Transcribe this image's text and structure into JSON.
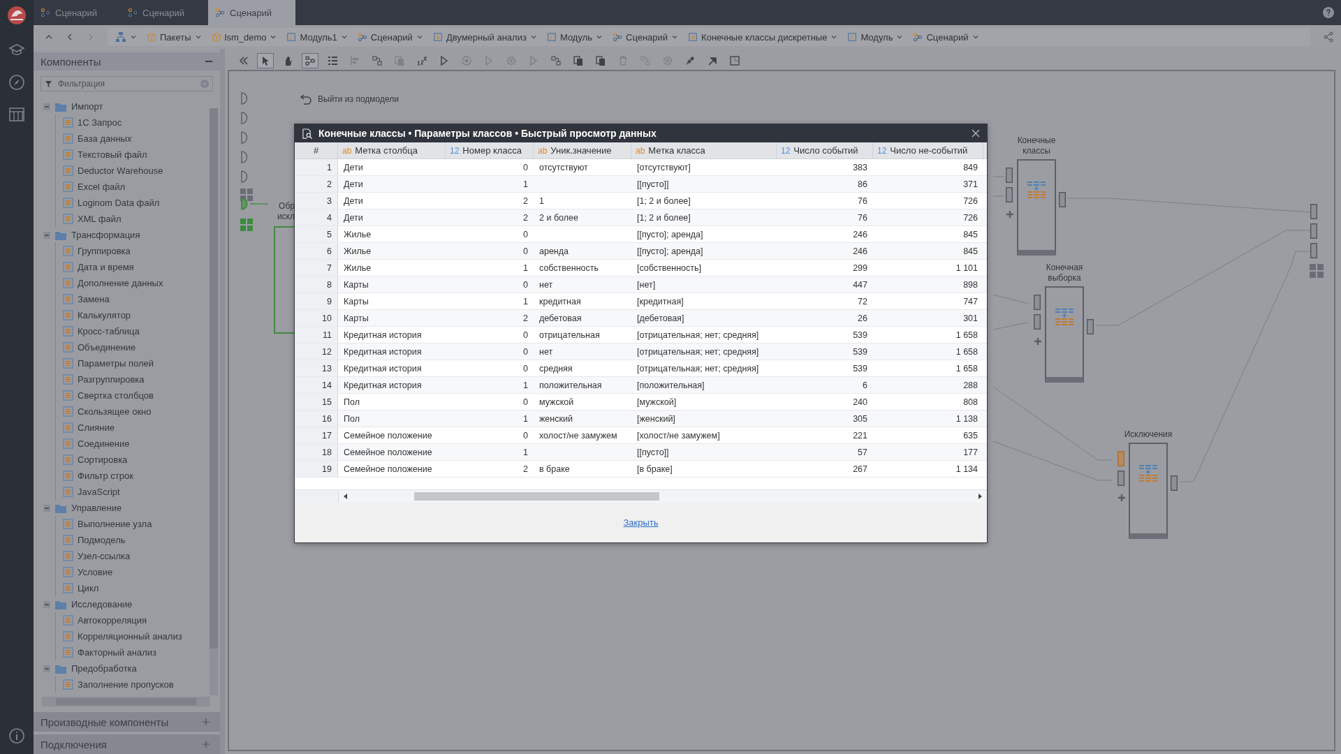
{
  "tabs": [
    {
      "label": "Сценарий",
      "selected": false
    },
    {
      "label": "Сценарий",
      "selected": false
    },
    {
      "label": "Сценарий",
      "selected": true
    }
  ],
  "breadcrumbs": [
    {
      "label": "Пакеты",
      "kind": "package"
    },
    {
      "label": "lsm_demo",
      "kind": "package"
    },
    {
      "label": "Модуль1",
      "kind": "module"
    },
    {
      "label": "Сценарий",
      "kind": "scenario"
    },
    {
      "label": "Двумерный анализ",
      "kind": "submodel"
    },
    {
      "label": "Модуль",
      "kind": "module"
    },
    {
      "label": "Сценарий",
      "kind": "scenario"
    },
    {
      "label": "Конечные классы дискретные",
      "kind": "submodel"
    },
    {
      "label": "Модуль",
      "kind": "module"
    },
    {
      "label": "Сценарий",
      "kind": "scenario"
    }
  ],
  "sidebar": {
    "title": "Компоненты",
    "filter": {
      "placeholder": "Фильтрация"
    },
    "tree": [
      {
        "label": "Импорт",
        "expanded": true,
        "children": [
          {
            "label": "1С Запрос"
          },
          {
            "label": "База данных"
          },
          {
            "label": "Текстовый файл"
          },
          {
            "label": "Deductor Warehouse"
          },
          {
            "label": "Excel файл"
          },
          {
            "label": "Loginom Data файл"
          },
          {
            "label": "XML файл"
          }
        ]
      },
      {
        "label": "Трансформация",
        "expanded": true,
        "children": [
          {
            "label": "Группировка"
          },
          {
            "label": "Дата и время"
          },
          {
            "label": "Дополнение данных"
          },
          {
            "label": "Замена"
          },
          {
            "label": "Калькулятор"
          },
          {
            "label": "Кросс-таблица"
          },
          {
            "label": "Объединение"
          },
          {
            "label": "Параметры полей"
          },
          {
            "label": "Разгруппировка"
          },
          {
            "label": "Свертка столбцов"
          },
          {
            "label": "Скользящее окно"
          },
          {
            "label": "Слияние"
          },
          {
            "label": "Соединение"
          },
          {
            "label": "Сортировка"
          },
          {
            "label": "Фильтр строк"
          },
          {
            "label": "JavaScript"
          }
        ]
      },
      {
        "label": "Управление",
        "expanded": true,
        "children": [
          {
            "label": "Выполнение узла"
          },
          {
            "label": "Подмодель"
          },
          {
            "label": "Узел-ссылка"
          },
          {
            "label": "Условие"
          },
          {
            "label": "Цикл"
          }
        ]
      },
      {
        "label": "Исследование",
        "expanded": true,
        "children": [
          {
            "label": "Автокорреляция"
          },
          {
            "label": "Корреляционный анализ"
          },
          {
            "label": "Факторный анализ"
          }
        ]
      },
      {
        "label": "Предобработка",
        "expanded": true,
        "children": [
          {
            "label": "Заполнение пропусков"
          }
        ]
      }
    ],
    "panels": [
      {
        "label": "Производные компоненты"
      },
      {
        "label": "Подключения"
      }
    ]
  },
  "toolbar": [
    {
      "kind": "collapse",
      "selected": false,
      "disabled": false
    },
    {
      "kind": "pointer",
      "selected": true,
      "disabled": false
    },
    {
      "kind": "hand",
      "selected": false,
      "disabled": false
    },
    {
      "kind": "graph",
      "selected": true,
      "disabled": false
    },
    {
      "kind": "list",
      "selected": false,
      "disabled": false
    },
    {
      "kind": "align",
      "selected": false,
      "disabled": true
    },
    {
      "kind": "layout",
      "selected": false,
      "disabled": false
    },
    {
      "kind": "copy",
      "selected": false,
      "disabled": true
    },
    {
      "kind": "numbers",
      "selected": false,
      "disabled": false
    },
    {
      "kind": "run",
      "selected": false,
      "disabled": false
    },
    {
      "kind": "stop",
      "selected": false,
      "disabled": true
    },
    {
      "kind": "run",
      "selected": false,
      "disabled": true
    },
    {
      "kind": "settings",
      "selected": false,
      "disabled": true
    },
    {
      "kind": "run",
      "selected": false,
      "disabled": true
    },
    {
      "kind": "layout",
      "selected": false,
      "disabled": false
    },
    {
      "kind": "copy",
      "selected": false,
      "disabled": false
    },
    {
      "kind": "copy",
      "selected": false,
      "disabled": false
    },
    {
      "kind": "delete",
      "selected": false,
      "disabled": true
    },
    {
      "kind": "layout",
      "selected": false,
      "disabled": true
    },
    {
      "kind": "settings",
      "selected": false,
      "disabled": true
    },
    {
      "kind": "link",
      "selected": false,
      "disabled": false
    },
    {
      "kind": "arrow",
      "selected": false,
      "disabled": false
    },
    {
      "kind": "select",
      "selected": false,
      "disabled": false
    }
  ],
  "canvas": {
    "exit_label": "Выйти из подмодели",
    "cut_label": [
      "Обр",
      "искл"
    ],
    "nodes": [
      {
        "label": "Конечные классы",
        "inputs": [
          {
            "warning": false
          },
          {
            "warning": false
          }
        ]
      },
      {
        "label": "Конечная выборка",
        "inputs": [
          {
            "warning": false
          },
          {
            "warning": false
          }
        ]
      },
      {
        "label": "Исключения",
        "inputs": [
          {
            "warning": true
          },
          {
            "warning": false
          }
        ]
      }
    ]
  },
  "dialog": {
    "title": "Конечные классы • Параметры классов • Быстрый просмотр данных",
    "columns": [
      {
        "label": "#",
        "kind": "index"
      },
      {
        "label": "Метка столбца",
        "kind": "text",
        "badge": "ab"
      },
      {
        "label": "Номер класса",
        "kind": "number",
        "badge": "12"
      },
      {
        "label": "Уник.значение",
        "kind": "text",
        "badge": "ab"
      },
      {
        "label": "Метка класса",
        "kind": "text",
        "badge": "ab"
      },
      {
        "label": "Число событий",
        "kind": "number",
        "badge": "12"
      },
      {
        "label": "Число не-событий",
        "kind": "number",
        "badge": "12"
      }
    ],
    "rows": [
      [
        "1",
        "Дети",
        "0",
        "отсутствуют",
        "[отсутствуют]",
        "383",
        "849"
      ],
      [
        "2",
        "Дети",
        "1",
        "",
        "[[пусто]]",
        "86",
        "371"
      ],
      [
        "3",
        "Дети",
        "2",
        "1",
        "[1; 2 и более]",
        "76",
        "726"
      ],
      [
        "4",
        "Дети",
        "2",
        "2 и более",
        "[1; 2 и более]",
        "76",
        "726"
      ],
      [
        "5",
        "Жилье",
        "0",
        "",
        "[[пусто]; аренда]",
        "246",
        "845"
      ],
      [
        "6",
        "Жилье",
        "0",
        "аренда",
        "[[пусто]; аренда]",
        "246",
        "845"
      ],
      [
        "7",
        "Жилье",
        "1",
        "собственность",
        "[собственность]",
        "299",
        "1 101"
      ],
      [
        "8",
        "Карты",
        "0",
        "нет",
        "[нет]",
        "447",
        "898"
      ],
      [
        "9",
        "Карты",
        "1",
        "кредитная",
        "[кредитная]",
        "72",
        "747"
      ],
      [
        "10",
        "Карты",
        "2",
        "дебетовая",
        "[дебетовая]",
        "26",
        "301"
      ],
      [
        "11",
        "Кредитная история",
        "0",
        "отрицательная",
        "[отрицательная; нет; средняя]",
        "539",
        "1 658"
      ],
      [
        "12",
        "Кредитная история",
        "0",
        "нет",
        "[отрицательная; нет; средняя]",
        "539",
        "1 658"
      ],
      [
        "13",
        "Кредитная история",
        "0",
        "средняя",
        "[отрицательная; нет; средняя]",
        "539",
        "1 658"
      ],
      [
        "14",
        "Кредитная история",
        "1",
        "положительная",
        "[положительная]",
        "6",
        "288"
      ],
      [
        "15",
        "Пол",
        "0",
        "мужской",
        "[мужской]",
        "240",
        "808"
      ],
      [
        "16",
        "Пол",
        "1",
        "женский",
        "[женский]",
        "305",
        "1 138"
      ],
      [
        "17",
        "Семейное положение",
        "0",
        "холост/не замужем",
        "[холост/не замужем]",
        "221",
        "635"
      ],
      [
        "18",
        "Семейное положение",
        "1",
        "",
        "[[пусто]]",
        "57",
        "177"
      ],
      [
        "19",
        "Семейное положение",
        "2",
        "в браке",
        "[в браке]",
        "267",
        "1 134"
      ]
    ],
    "close_link": "Закрыть"
  }
}
